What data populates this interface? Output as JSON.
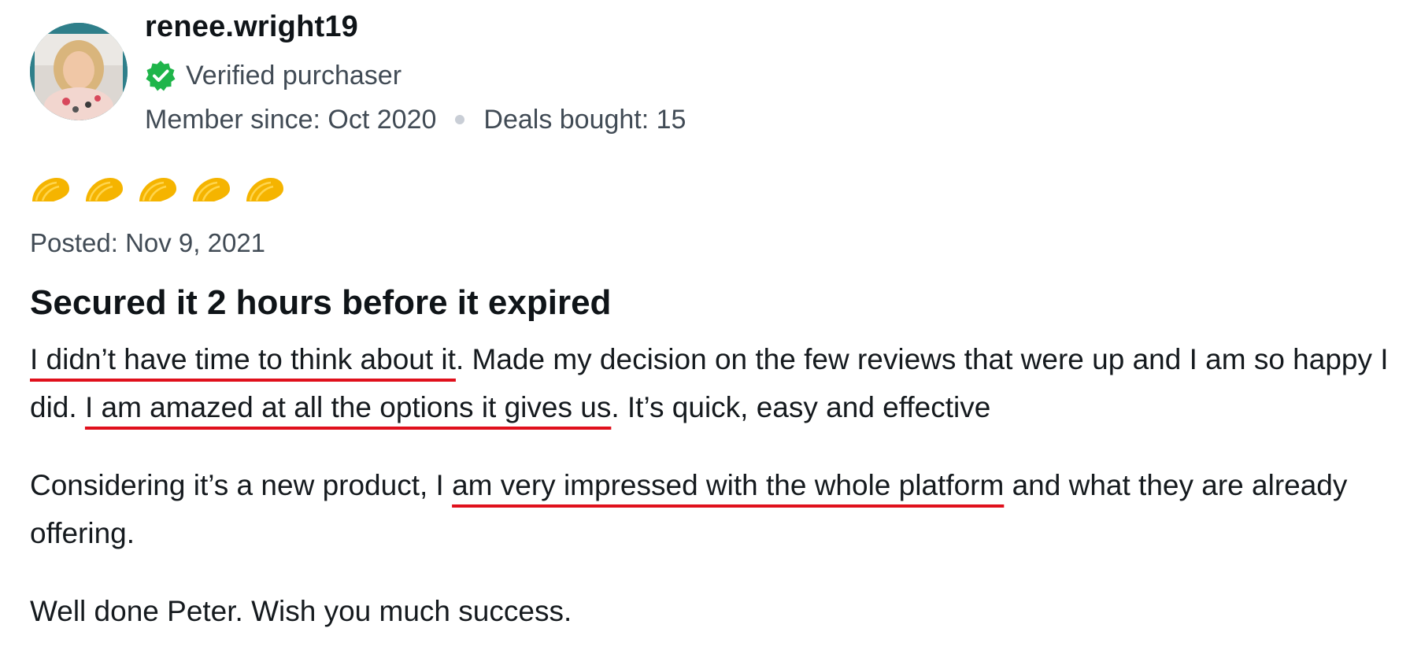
{
  "reviewer": {
    "username": "renee.wright19",
    "verified_label": "Verified purchaser",
    "member_since": "Member since: Oct 2020",
    "deals_bought": "Deals bought: 15"
  },
  "rating": {
    "value": 5,
    "max": 5,
    "icon": "taco-icon",
    "color": "#f5b400"
  },
  "posted": "Posted: Nov 9, 2021",
  "review": {
    "title": "Secured it 2 hours before it expired",
    "paragraphs": [
      {
        "highlight_1": "I didn’t have time to think about it",
        "text_1": ". Made my decision on the few reviews that were up and I am so happy I did. ",
        "highlight_2": "I am amazed at all the options it gives us",
        "text_2": ". It’s quick, easy and effective"
      },
      {
        "text_1": "Considering it’s a new product, I ",
        "highlight_1": "am very impressed with the whole platform",
        "text_2": " and what they are already offering."
      },
      {
        "text_1": "Well done Peter. Wish you much success."
      }
    ],
    "highlight_color": "#e0101c"
  },
  "colors": {
    "verified_badge": "#1fb54a",
    "username": "#0f1418",
    "meta_text": "#414b55"
  }
}
